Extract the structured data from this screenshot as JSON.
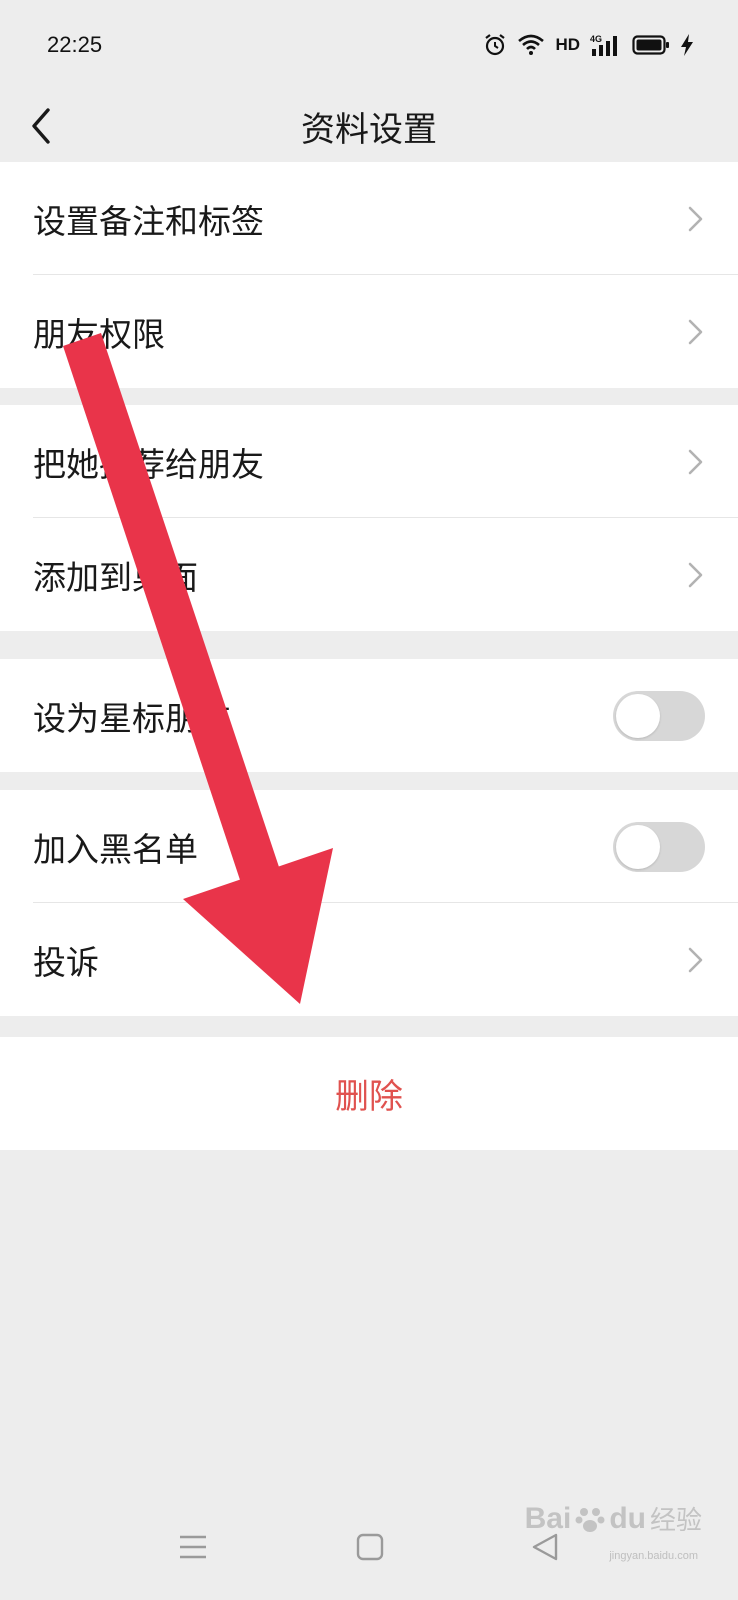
{
  "status_bar": {
    "time": "22:25",
    "hd": "HD",
    "network": "4G",
    "icons": [
      "alarm-icon",
      "wifi-icon",
      "signal-icon",
      "battery-icon",
      "charging-icon"
    ]
  },
  "nav": {
    "title": "资料设置",
    "back_icon": "back-chevron-icon"
  },
  "groups": [
    {
      "items": [
        {
          "label": "设置备注和标签",
          "control": "chevron"
        },
        {
          "label": "朋友权限",
          "control": "chevron"
        }
      ]
    },
    {
      "items": [
        {
          "label": "把她推荐给朋友",
          "control": "chevron"
        },
        {
          "label": "添加到桌面",
          "control": "chevron"
        }
      ]
    },
    {
      "items": [
        {
          "label": "设为星标朋友",
          "control": "toggle",
          "on": false
        }
      ]
    },
    {
      "items": [
        {
          "label": "加入黑名单",
          "control": "toggle",
          "on": false
        },
        {
          "label": "投诉",
          "control": "chevron"
        }
      ]
    }
  ],
  "delete": {
    "label": "删除",
    "color": "#e0524f"
  },
  "annotation": {
    "color": "#e9344a",
    "icon": "red-arrow-annotation"
  },
  "watermark": {
    "main": "Bai",
    "paw": "paw-icon",
    "du": "du",
    "sub": "经验",
    "domain": "jingyan.baidu.com"
  },
  "colors": {
    "background": "#ededed",
    "card": "#ffffff",
    "toggle_off": "#d7d7d7"
  }
}
